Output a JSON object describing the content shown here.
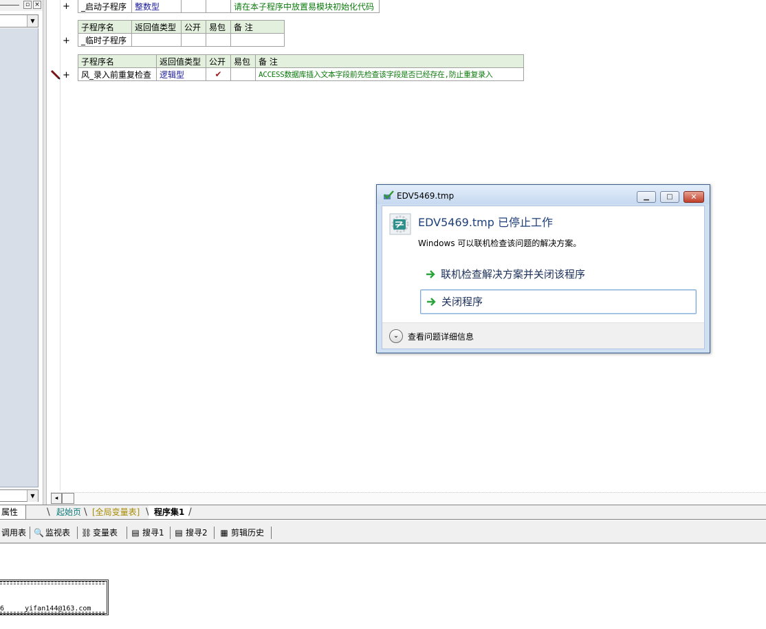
{
  "left_panel": {
    "restore_glyph": "▫",
    "close_glyph": "×",
    "dropdown_glyph": "▼"
  },
  "editor": {
    "plus": "+",
    "table1": {
      "row": {
        "name": "_启动子程序",
        "type": "整数型",
        "public": "",
        "pkg": "",
        "note": "请在本子程序中放置易模块初始化代码"
      }
    },
    "table2": {
      "headers": {
        "name": "子程序名",
        "type": "返回值类型",
        "public": "公开",
        "pkg": "易包",
        "note": "备 注"
      },
      "row": {
        "name": "_临时子程序",
        "type": "",
        "public": "",
        "pkg": "",
        "note": ""
      }
    },
    "table3": {
      "headers": {
        "name": "子程序名",
        "type": "返回值类型",
        "public": "公开",
        "pkg": "易包",
        "note": "备 注"
      },
      "row": {
        "name": "风_录入前重复检查",
        "type": "逻辑型",
        "public": "✔",
        "pkg": "",
        "note": "ACCESS数据库插入文本字段前先检查该字段是否已经存在,防止重复录入"
      }
    },
    "hscroll_left": "◂"
  },
  "tabs": {
    "properties": "属性",
    "start_page": "起始页",
    "global_vars": "[全局变量表]",
    "program_set": "程序集1"
  },
  "toolbar": {
    "items": [
      {
        "label": "调用表",
        "icon": "call-table-icon"
      },
      {
        "label": "监视表",
        "icon": "magnifier-icon",
        "glyph": "🔍"
      },
      {
        "label": "变量表",
        "icon": "variables-icon",
        "glyph": "⛓"
      },
      {
        "label": "搜寻1",
        "icon": "search-list-icon",
        "glyph": "▤"
      },
      {
        "label": "搜寻2",
        "icon": "search-list-icon",
        "glyph": "▤"
      },
      {
        "label": "剪辑历史",
        "icon": "clipboard-history-icon",
        "glyph": "▦"
      }
    ]
  },
  "output": {
    "line": "6     yifan144@163.com"
  },
  "dialog": {
    "title": "EDV5469.tmp",
    "heading": "EDV5469.tmp 已停止工作",
    "subtext": "Windows 可以联机检查该问题的解决方案。",
    "option_check": "联机检查解决方案并关闭该程序",
    "option_close": "关闭程序",
    "details": "查看问题详细信息",
    "min_glyph": "▁",
    "max_glyph": "□",
    "close_glyph": "✕",
    "expand_glyph": "⌄",
    "colors": {
      "heading": "#1d3f7a",
      "arrow": "#2aa33a",
      "close_button": "#c1402a"
    }
  }
}
